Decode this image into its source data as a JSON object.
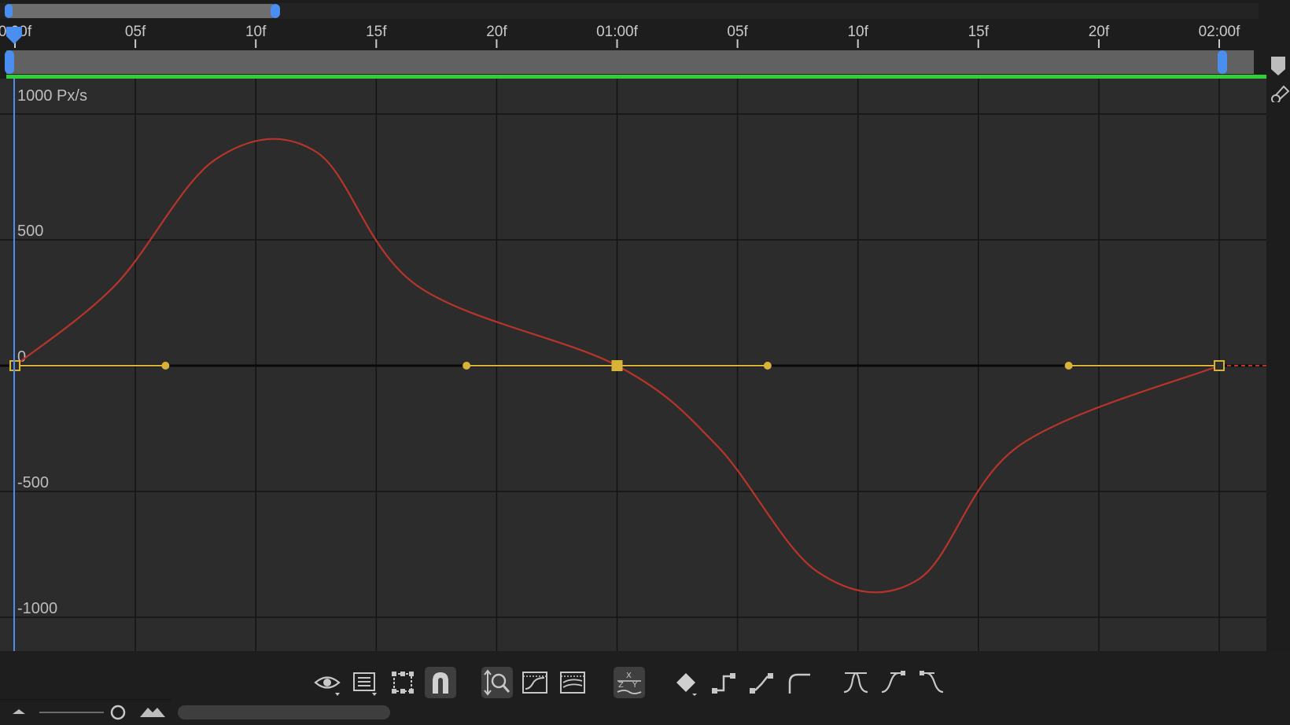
{
  "ruler": {
    "tick_labels": [
      "0:00f",
      "05f",
      "10f",
      "15f",
      "20f",
      "01:00f",
      "05f",
      "10f",
      "15f",
      "20f",
      "02:00f"
    ]
  },
  "graph": {
    "unit_label": "1000 Px/s",
    "y_labels": [
      "500",
      "0",
      "-500",
      "-1000"
    ],
    "colors": {
      "background": "#2c2c2c",
      "grid": "#141414",
      "curve": "#b8342b",
      "handle": "#d9b23a",
      "work_area": "#2fcf3a",
      "playhead": "#4a8ef0"
    }
  },
  "chart_data": {
    "type": "line",
    "xlabel": "",
    "ylabel": "",
    "x_unit": "frames",
    "xlim": [
      0,
      60
    ],
    "ylim": [
      -1000,
      1000
    ],
    "series": [
      {
        "x": [
          0,
          5,
          10,
          15,
          20,
          30,
          35,
          40,
          45,
          50,
          60
        ],
        "y": [
          0,
          320,
          820,
          850,
          320,
          0,
          -320,
          -820,
          -850,
          -320,
          0
        ]
      }
    ],
    "keyframes": [
      {
        "frame": 0,
        "value": 0
      },
      {
        "frame": 30,
        "value": 0
      },
      {
        "frame": 60,
        "value": 0
      }
    ],
    "handles": [
      {
        "frame": 7.5,
        "value": 0
      },
      {
        "frame": 22.5,
        "value": 0
      },
      {
        "frame": 37.5,
        "value": 0
      },
      {
        "frame": 52.5,
        "value": 0
      }
    ],
    "peaks": [
      {
        "frame": 15,
        "value": 950
      },
      {
        "frame": 45,
        "value": -950
      }
    ]
  },
  "toolbar": {
    "icons": [
      "eye-icon",
      "list-icon",
      "transform-box-icon",
      "snap-magnet-icon",
      "fit-zoom-icon",
      "fit-all-icon",
      "graph-overlay-icon",
      "separate-dimensions-icon",
      "keyframe-diamond-icon",
      "hold-icon",
      "linear-icon",
      "auto-bezier-icon",
      "easy-ease-icon",
      "ease-in-icon",
      "ease-out-icon"
    ]
  }
}
